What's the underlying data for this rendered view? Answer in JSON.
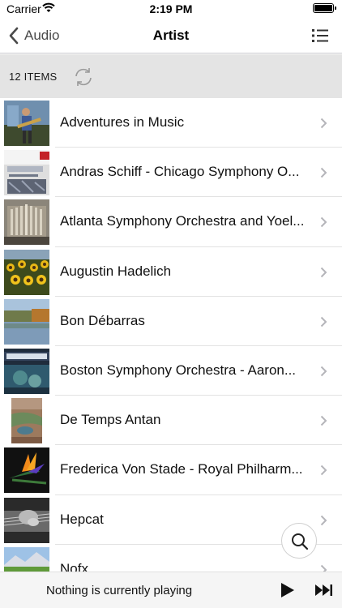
{
  "status_bar": {
    "carrier": "Carrier",
    "time": "2:19 PM"
  },
  "nav": {
    "back_label": "Audio",
    "title": "Artist"
  },
  "items_bar": {
    "count_label": "12 ITEMS"
  },
  "artists": [
    {
      "name": "Adventures in Music",
      "thumb": "guitarist-thumb"
    },
    {
      "name": "Andras Schiff - Chicago Symphony O...",
      "thumb": "wagner-album-thumb"
    },
    {
      "name": "Atlanta Symphony Orchestra and Yoel...",
      "thumb": "organ-thumb"
    },
    {
      "name": "Augustin Hadelich",
      "thumb": "sunflowers-thumb"
    },
    {
      "name": "Bon Débarras",
      "thumb": "lake-thumb"
    },
    {
      "name": "Boston Symphony Orchestra - Aaron...",
      "thumb": "respighi-album-thumb"
    },
    {
      "name": "De Temps Antan",
      "thumb": "aerial-landscape-thumb"
    },
    {
      "name": "Frederica Von Stade - Royal Philharm...",
      "thumb": "bird-of-paradise-thumb"
    },
    {
      "name": "Hepcat",
      "thumb": "guitar-hands-thumb"
    },
    {
      "name": "Nofx",
      "thumb": "mountain-meadow-thumb"
    }
  ],
  "now_playing": {
    "text": "Nothing is currently playing"
  }
}
